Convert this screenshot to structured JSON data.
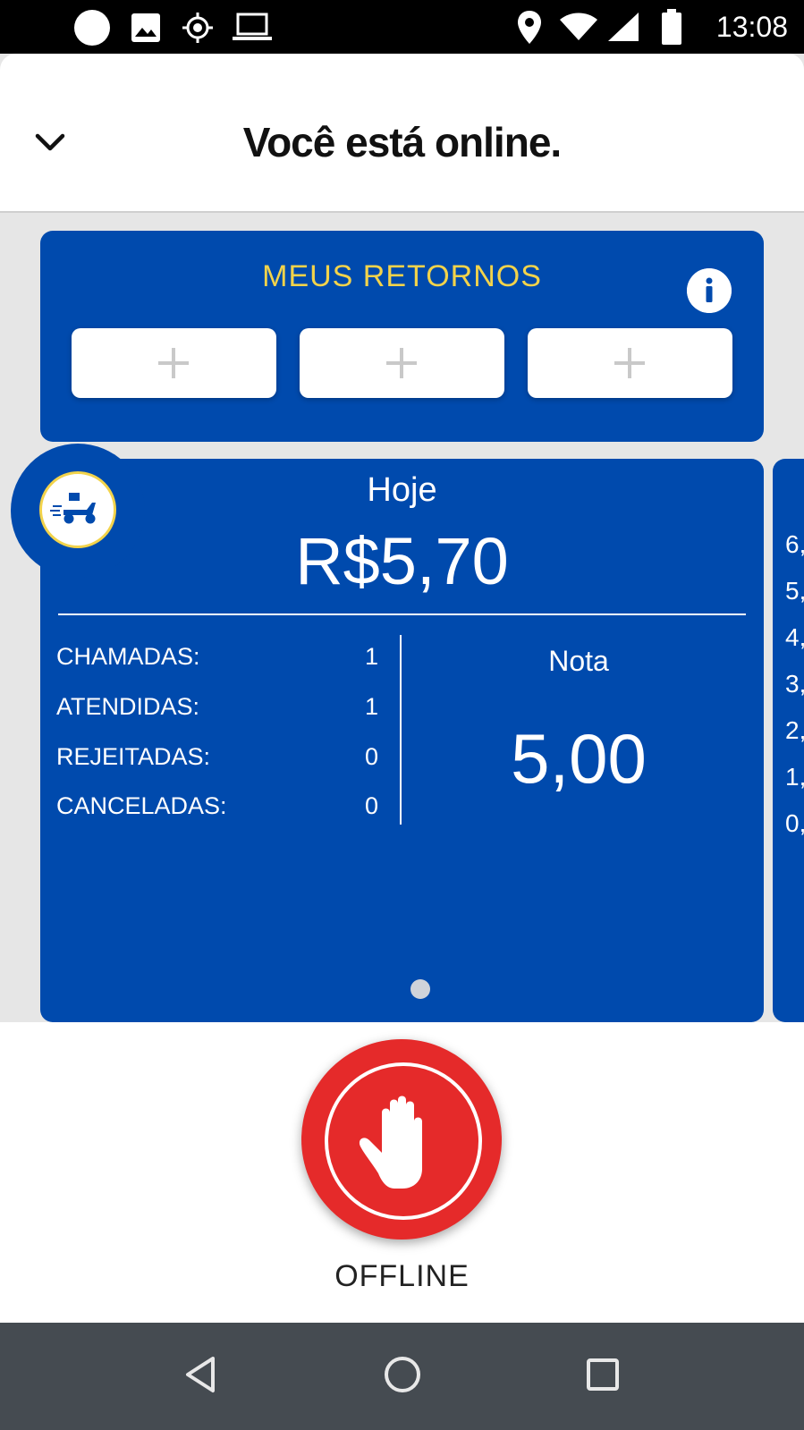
{
  "status_bar": {
    "time": "13:08",
    "icons": [
      "circle-icon",
      "image-icon",
      "gps-icon",
      "laptop-icon",
      "location-icon",
      "wifi-icon",
      "signal-icon",
      "battery-icon"
    ]
  },
  "header": {
    "title": "Você está online.",
    "back_icon": "chevron-down-icon"
  },
  "retornos": {
    "title": "MEUS RETORNOS",
    "info_icon": "info-icon",
    "slots": [
      "+",
      "+",
      "+"
    ]
  },
  "stats": {
    "period": "Hoje",
    "earnings": "R$5,70",
    "rows": [
      {
        "label": "CHAMADAS:",
        "value": "1"
      },
      {
        "label": "ATENDIDAS:",
        "value": "1"
      },
      {
        "label": "REJEITADAS:",
        "value": "0"
      },
      {
        "label": "CANCELADAS:",
        "value": "0"
      }
    ],
    "nota_label": "Nota",
    "nota_value": "5,00",
    "avatar_icon": "scooter-delivery-icon"
  },
  "next_card": {
    "values": [
      "6,",
      "5,",
      "4,",
      "3,",
      "2,",
      "1,",
      "0,"
    ]
  },
  "offline": {
    "label": "OFFLINE",
    "icon": "hand-stop-icon",
    "color": "#e52a2a"
  },
  "colors": {
    "brand_blue": "#004aad",
    "accent_yellow": "#f2d34b"
  },
  "nav": {
    "icons": [
      "back-triangle-icon",
      "home-circle-icon",
      "recents-square-icon"
    ]
  }
}
